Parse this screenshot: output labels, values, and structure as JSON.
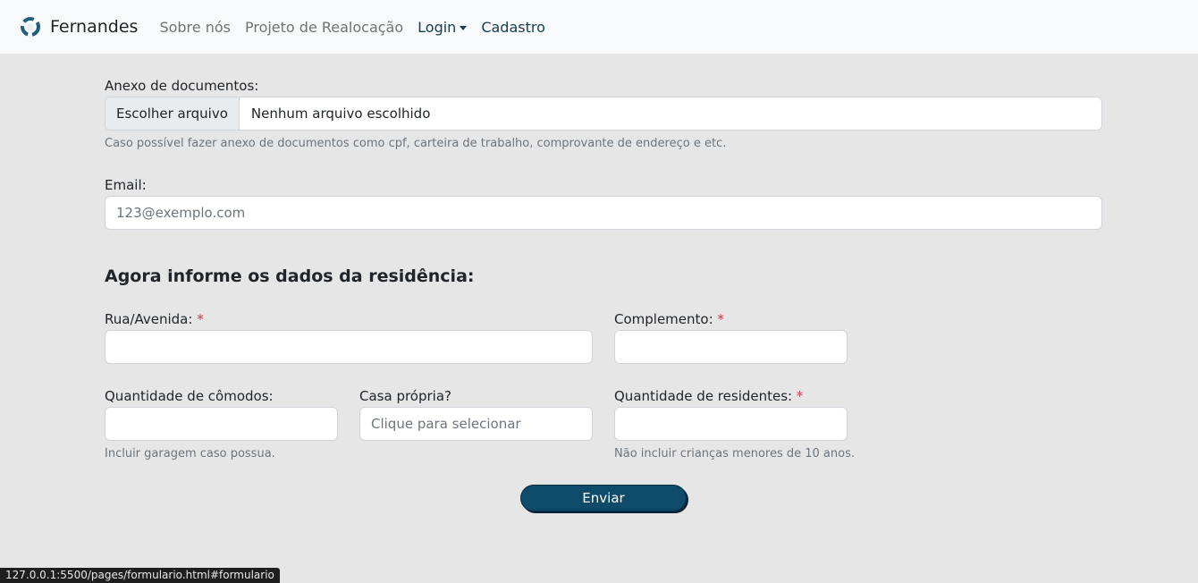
{
  "navbar": {
    "brand": "Fernandes",
    "brand_icon": "recycle-logo-icon",
    "links": [
      "Sobre nós",
      "Projeto de Realocação",
      "Login",
      "Cadastro"
    ]
  },
  "form": {
    "attachments": {
      "label": "Anexo de documentos:",
      "button": "Escolher arquivo",
      "file_name": "Nenhum arquivo escolhido",
      "help": "Caso possível fazer anexo de documentos como cpf, carteira de trabalho, comprovante de endereço e etc."
    },
    "email": {
      "label": "Email:",
      "placeholder": "123@exemplo.com"
    },
    "section_title": "Agora informe os dados da residência:",
    "street": {
      "label": "Rua/Avenida:",
      "required": "*"
    },
    "complement": {
      "label": "Complemento:",
      "required": "*"
    },
    "rooms": {
      "label": "Quantidade de cômodos:",
      "help": "Incluir garagem caso possua."
    },
    "own_house": {
      "label": "Casa própria?",
      "placeholder": "Clique para selecionar"
    },
    "residents": {
      "label": "Quantidade de residentes:",
      "required": "*",
      "help": "Não incluir crianças menores de 10 anos."
    },
    "submit": "Enviar"
  },
  "status_bar": "127.0.0.1:5500/pages/formulario.html#formulario",
  "colors": {
    "accent": "#0e4a6a",
    "required": "#dc3545",
    "background": "#e6e6e6"
  }
}
